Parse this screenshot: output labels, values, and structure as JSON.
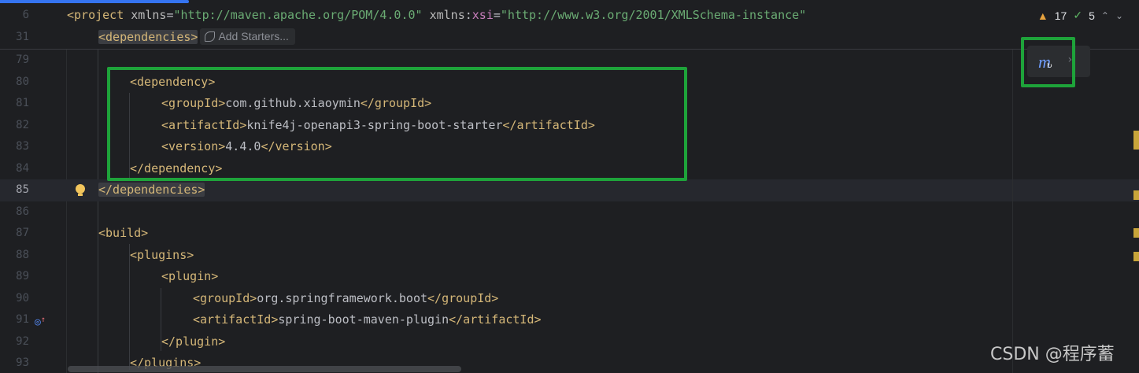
{
  "sticky_lines": [
    {
      "num": "6",
      "tag_open": "<project ",
      "a1": "xmlns",
      "eq1": "=",
      "s1": "\"http://maven.apache.org/POM/4.0.0\"",
      "a2": " xmlns",
      "colon": ":",
      "ns": "xsi",
      "eq2": "=",
      "s2": "\"http://www.w3.org/2001/XMLSchema-instance\""
    },
    {
      "num": "31",
      "tag": "<dependencies>",
      "hint": "Add Starters..."
    }
  ],
  "inspection": {
    "warnings": "17",
    "ok": "5"
  },
  "lines": [
    {
      "num": "79",
      "text": ""
    },
    {
      "num": "80",
      "tag1": "<dependency>"
    },
    {
      "num": "81",
      "tag1": "<groupId>",
      "value": "com.github.xiaoymin",
      "tag2": "</groupId>"
    },
    {
      "num": "82",
      "tag1": "<artifactId>",
      "value": "knife4j-openapi3-spring-boot-starter",
      "tag2": "</artifactId>"
    },
    {
      "num": "83",
      "tag1": "<version>",
      "value": "4.4.0",
      "tag2": "</version>"
    },
    {
      "num": "84",
      "tag1": "</dependency>"
    },
    {
      "num": "85",
      "tag1": "</dependencies>"
    },
    {
      "num": "86",
      "text": ""
    },
    {
      "num": "87",
      "tag1": "<build>"
    },
    {
      "num": "88",
      "tag1": "<plugins>"
    },
    {
      "num": "89",
      "tag1": "<plugin>"
    },
    {
      "num": "90",
      "tag1": "<groupId>",
      "value": "org.springframework.boot",
      "tag2": "</groupId>"
    },
    {
      "num": "91",
      "tag1": "<artifactId>",
      "value": "spring-boot-maven-plugin",
      "tag2": "</artifactId>"
    },
    {
      "num": "92",
      "tag1": "</plugin>"
    },
    {
      "num": "93",
      "tag1": "</plugins>"
    }
  ],
  "icons": {
    "maven": "maven-icon",
    "refresh": "refresh-icon",
    "bulb": "lightbulb-icon",
    "gutter": "run-icon"
  },
  "colors": {
    "highlight_box": "#1ea33a",
    "tag": "#d5b778",
    "string": "#6aab73",
    "accent": "#3574f0"
  },
  "watermark": "CSDN @程序蓄"
}
